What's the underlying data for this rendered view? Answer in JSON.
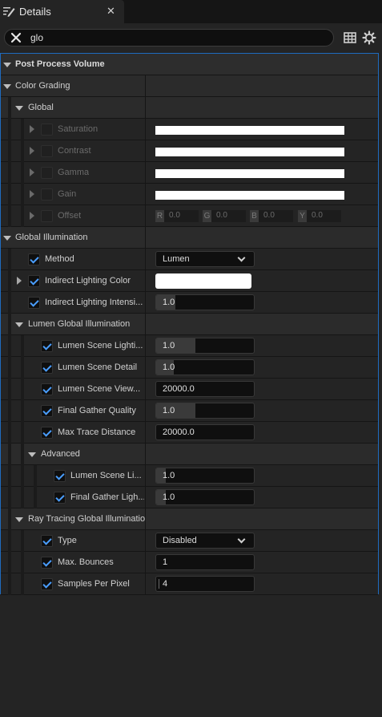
{
  "tab": {
    "title": "Details",
    "close": "✕"
  },
  "search": {
    "value": "glo"
  },
  "sections": {
    "post_process_volume": "Post Process Volume",
    "color_grading": "Color Grading",
    "global": "Global",
    "global_illumination": "Global Illumination",
    "lumen_gi": "Lumen Global Illumination",
    "advanced": "Advanced",
    "ray_tracing_gi": "Ray Tracing Global Illuminatio"
  },
  "color_grading": {
    "saturation": "Saturation",
    "contrast": "Contrast",
    "gamma": "Gamma",
    "gain": "Gain",
    "offset": "Offset",
    "offset_components": [
      {
        "tag": "R",
        "value": "0.0"
      },
      {
        "tag": "G",
        "value": "0.0"
      },
      {
        "tag": "B",
        "value": "0.0"
      },
      {
        "tag": "Y",
        "value": "0.0"
      }
    ]
  },
  "gi": {
    "method_label": "Method",
    "method_value": "Lumen",
    "indirect_color_label": "Indirect Lighting Color",
    "indirect_intensity_label": "Indirect Lighting Intensi...",
    "indirect_intensity_value": "1.0",
    "indirect_intensity_fraction": 0.2
  },
  "lumen": {
    "scene_lighting_label": "Lumen Scene Lighti...",
    "scene_lighting_value": "1.0",
    "scene_lighting_fraction": 0.4,
    "scene_detail_label": "Lumen Scene Detail",
    "scene_detail_value": "1.0",
    "scene_detail_fraction": 0.18,
    "scene_view_label": "Lumen Scene View...",
    "scene_view_value": "20000.0",
    "final_gather_label": "Final Gather Quality",
    "final_gather_value": "1.0",
    "final_gather_fraction": 0.4,
    "max_trace_label": "Max Trace Distance",
    "max_trace_value": "20000.0"
  },
  "advanced": {
    "scene_li_label": "Lumen Scene Li...",
    "scene_li_value": "1.0",
    "scene_li_fraction": 0.1,
    "final_gather_ligh_label": "Final Gather Ligh...",
    "final_gather_ligh_value": "1.0",
    "final_gather_ligh_fraction": 0.1
  },
  "ray_tracing": {
    "type_label": "Type",
    "type_value": "Disabled",
    "max_bounces_label": "Max. Bounces",
    "max_bounces_value": "1",
    "samples_label": "Samples Per Pixel",
    "samples_value": "4"
  },
  "icons": {
    "tab": "details-pencil-icon",
    "clear": "close-icon",
    "table_view": "table-icon",
    "settings": "gear-icon"
  }
}
